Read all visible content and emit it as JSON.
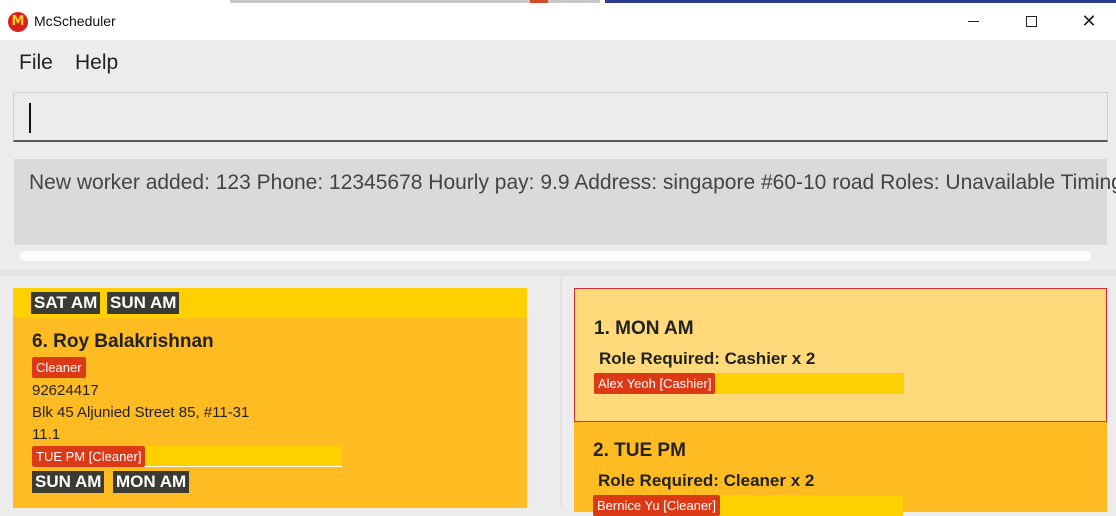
{
  "window": {
    "title": "McScheduler",
    "logo_letter": "M"
  },
  "menu": {
    "file": "File",
    "help": "Help"
  },
  "command": {
    "value": ""
  },
  "result": {
    "message": "New worker added: 123 Phone: 12345678 Hourly pay: 9.9 Address: singapore #60-10 road Roles:  Unavailable Timings:"
  },
  "worker_list": {
    "prev_card_unavailable": [
      "SAT AM",
      "SUN AM"
    ],
    "worker": {
      "index_name": "6.  Roy Balakrishnan",
      "role": "Cleaner",
      "phone": "92624417",
      "address": "Blk 45 Aljunied Street 85, #11-31",
      "pay": "11.1",
      "assigned_shift": "TUE PM [Cleaner]",
      "unavailable": [
        "SUN AM",
        "MON AM"
      ]
    }
  },
  "shift_list": [
    {
      "title": "1.  MON AM",
      "role_required": "Role Required: Cashier x 2",
      "assigned": "Alex Yeoh [Cashier]"
    },
    {
      "title": "2.  TUE PM",
      "role_required": "Role Required: Cleaner x 2",
      "assigned": "Bernice Yu [Cleaner]"
    }
  ],
  "colors": {
    "card_yellow": "#ffbb22",
    "selected_card": "#ffd97a",
    "tag_red": "#dc3a17",
    "tag_dark": "#3b3a33",
    "bar_yellow": "#ffd000"
  }
}
